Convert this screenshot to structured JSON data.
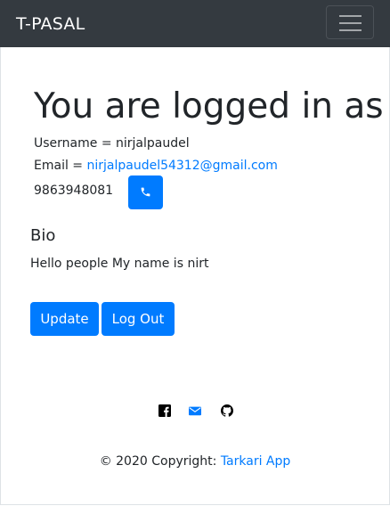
{
  "navbar": {
    "brand": "T-PASAL",
    "toggler_icon": "hamburger-menu-icon"
  },
  "profile": {
    "heading": "You are logged in as",
    "username_label": "Username = ",
    "username": "nirjalpaudel",
    "email_label": "Email = ",
    "email": "nirjalpaudel54312@gmail.com",
    "phone": "9863948081",
    "phone_icon": "phone-icon"
  },
  "bio": {
    "title": "Bio",
    "text": "Hello people My name is nirt"
  },
  "actions": {
    "update_label": "Update",
    "logout_label": "Log Out"
  },
  "social": {
    "icons": [
      "facebook-icon",
      "envelope-icon",
      "github-icon"
    ]
  },
  "footer": {
    "copyright": "© 2020 Copyright: ",
    "link": "Tarkari App"
  },
  "colors": {
    "navbar_bg": "#343a40",
    "primary": "#007bff",
    "text": "#212529"
  }
}
